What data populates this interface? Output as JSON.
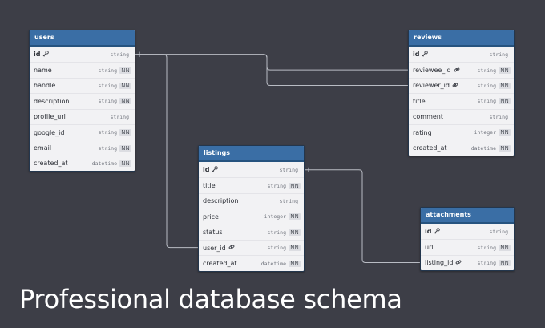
{
  "tables": [
    {
      "id": "users",
      "name": "users",
      "columns": [
        {
          "name": "id",
          "type": "string",
          "nn": "",
          "pk": true,
          "fk": false
        },
        {
          "name": "name",
          "type": "string",
          "nn": "NN",
          "pk": false,
          "fk": false
        },
        {
          "name": "handle",
          "type": "string",
          "nn": "NN",
          "pk": false,
          "fk": false
        },
        {
          "name": "description",
          "type": "string",
          "nn": "NN",
          "pk": false,
          "fk": false
        },
        {
          "name": "profile_url",
          "type": "string",
          "nn": "",
          "pk": false,
          "fk": false
        },
        {
          "name": "google_id",
          "type": "string",
          "nn": "NN",
          "pk": false,
          "fk": false
        },
        {
          "name": "email",
          "type": "string",
          "nn": "NN",
          "pk": false,
          "fk": false
        },
        {
          "name": "created_at",
          "type": "datetime",
          "nn": "NN",
          "pk": false,
          "fk": false
        }
      ]
    },
    {
      "id": "reviews",
      "name": "reviews",
      "columns": [
        {
          "name": "id",
          "type": "string",
          "nn": "",
          "pk": true,
          "fk": false
        },
        {
          "name": "reviewee_id",
          "type": "string",
          "nn": "NN",
          "pk": false,
          "fk": true
        },
        {
          "name": "reviewer_id",
          "type": "string",
          "nn": "NN",
          "pk": false,
          "fk": true
        },
        {
          "name": "title",
          "type": "string",
          "nn": "NN",
          "pk": false,
          "fk": false
        },
        {
          "name": "comment",
          "type": "string",
          "nn": "",
          "pk": false,
          "fk": false
        },
        {
          "name": "rating",
          "type": "integer",
          "nn": "NN",
          "pk": false,
          "fk": false
        },
        {
          "name": "created_at",
          "type": "datetime",
          "nn": "NN",
          "pk": false,
          "fk": false
        }
      ]
    },
    {
      "id": "listings",
      "name": "listings",
      "columns": [
        {
          "name": "id",
          "type": "string",
          "nn": "",
          "pk": true,
          "fk": false
        },
        {
          "name": "title",
          "type": "string",
          "nn": "NN",
          "pk": false,
          "fk": false
        },
        {
          "name": "description",
          "type": "string",
          "nn": "",
          "pk": false,
          "fk": false
        },
        {
          "name": "price",
          "type": "integer",
          "nn": "NN",
          "pk": false,
          "fk": false
        },
        {
          "name": "status",
          "type": "string",
          "nn": "NN",
          "pk": false,
          "fk": false
        },
        {
          "name": "user_id",
          "type": "string",
          "nn": "NN",
          "pk": false,
          "fk": true
        },
        {
          "name": "created_at",
          "type": "datetime",
          "nn": "NN",
          "pk": false,
          "fk": false
        }
      ]
    },
    {
      "id": "attachments",
      "name": "attachments",
      "columns": [
        {
          "name": "id",
          "type": "string",
          "nn": "",
          "pk": true,
          "fk": false
        },
        {
          "name": "url",
          "type": "string",
          "nn": "NN",
          "pk": false,
          "fk": false
        },
        {
          "name": "listing_id",
          "type": "string",
          "nn": "NN",
          "pk": false,
          "fk": true
        }
      ]
    }
  ],
  "relations": [
    {
      "from_table": "users",
      "from_column": "id",
      "to_table": "reviews",
      "to_column": "reviewee_id"
    },
    {
      "from_table": "users",
      "from_column": "id",
      "to_table": "reviews",
      "to_column": "reviewer_id"
    },
    {
      "from_table": "users",
      "from_column": "id",
      "to_table": "listings",
      "to_column": "user_id"
    },
    {
      "from_table": "listings",
      "from_column": "id",
      "to_table": "attachments",
      "to_column": "listing_id"
    }
  ],
  "caption": "Professional database schema",
  "colors": {
    "background": "#3d3e47",
    "table_header": "#3a6ea5",
    "table_body": "#f2f2f4",
    "connector": "#b9bcc4"
  }
}
